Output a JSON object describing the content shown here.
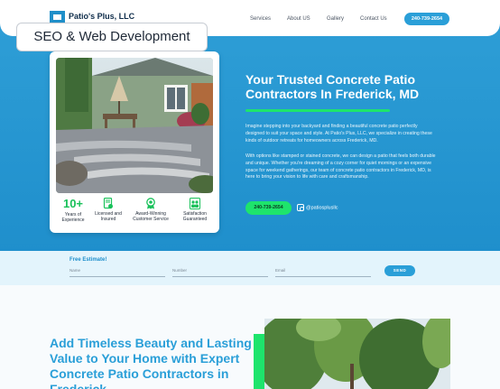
{
  "header": {
    "logo_text": "Patio's Plus, LLC",
    "nav": [
      "Services",
      "About US",
      "Gallery",
      "Contact Us"
    ],
    "phone": "240-739-2654"
  },
  "badge": {
    "label": "SEO & Web Development"
  },
  "hero": {
    "title": "Your Trusted Concrete Patio Contractors In Frederick, MD",
    "paragraph1": "Imagine stepping into your backyard and finding a beautiful concrete patio perfectly designed to suit your space and style. At Patio's Plus, LLC, we specialize in creating these kinds of outdoor retreats for homeowners across Frederick, MD.",
    "paragraph2": "With options like stamped or stained concrete, we can design a patio that feels both durable and unique. Whether you're dreaming of a cozy corner for quiet mornings or an expensive space for weekend gatherings, our team of concrete patio contractors in Frederick, MD, is here to bring your vision to life with care and craftsmanship.",
    "cta": "240-739-2654",
    "instagram": "@patiosplusllc"
  },
  "stats": [
    {
      "big": "10+",
      "label": "Years of Experience",
      "icon": ""
    },
    {
      "big": "",
      "label": "Licensed and Insured",
      "icon": "document-check-icon"
    },
    {
      "big": "",
      "label": "Award-Winning Customer Service",
      "icon": "award-icon"
    },
    {
      "big": "",
      "label": "Satisfaction Guaranteed",
      "icon": "team-icon"
    }
  ],
  "estimate": {
    "title": "Free Estimate!",
    "fields": [
      "Name",
      "Number",
      "Email"
    ],
    "send": "SEND"
  },
  "lower": {
    "title": "Add Timeless Beauty and Lasting Value to Your Home with Expert Concrete Patio Contractors in Frederick"
  },
  "colors": {
    "brand_blue": "#2a9fd8",
    "accent_green": "#1ee46c",
    "navy": "#0e2c4a"
  }
}
